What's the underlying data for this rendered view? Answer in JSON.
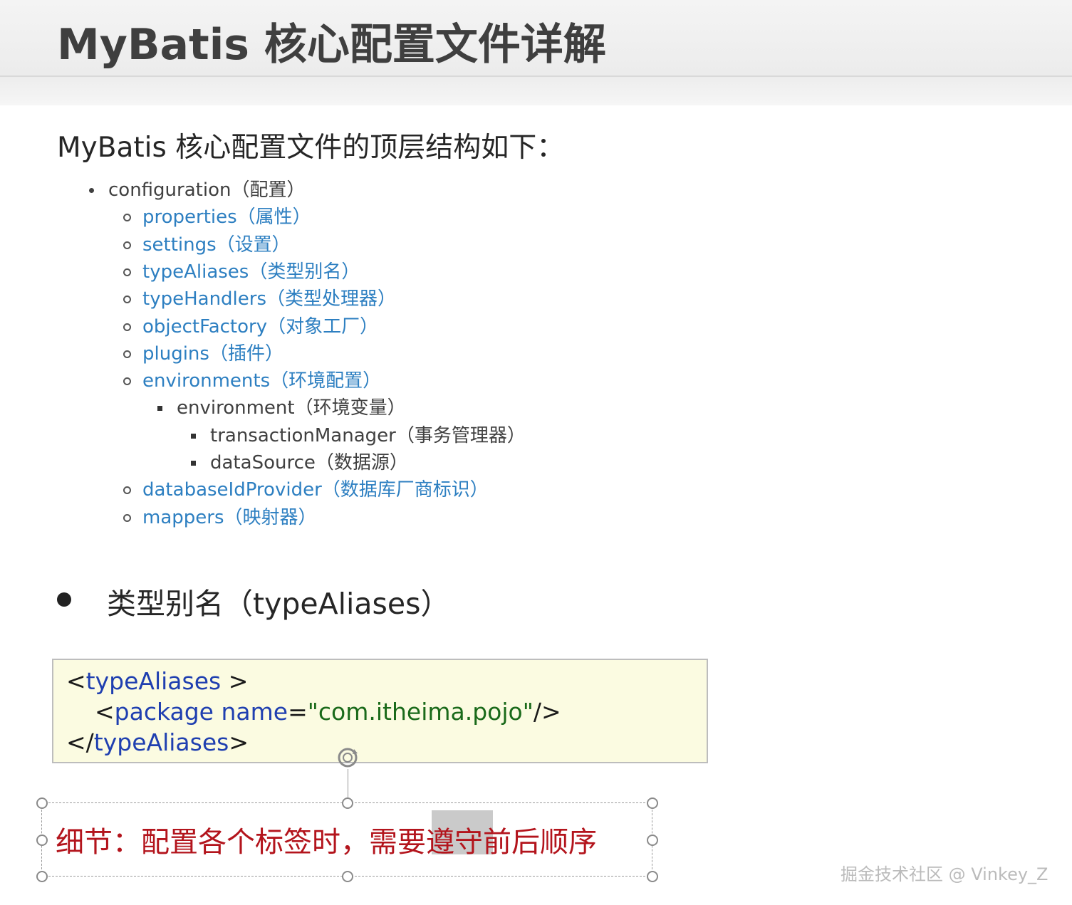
{
  "slide": {
    "title": "MyBatis 核心配置文件详解",
    "intro": "MyBatis 核心配置文件的顶层结构如下：",
    "tree": [
      {
        "level": 1,
        "marker": "disc",
        "label": "configuration（配置）"
      },
      {
        "level": 2,
        "marker": "circle",
        "label": "properties（属性）"
      },
      {
        "level": 2,
        "marker": "circle",
        "label": "settings（设置）"
      },
      {
        "level": 2,
        "marker": "circle",
        "label": "typeAliases（类型别名）"
      },
      {
        "level": 2,
        "marker": "circle",
        "label": "typeHandlers（类型处理器）"
      },
      {
        "level": 2,
        "marker": "circle",
        "label": "objectFactory（对象工厂）"
      },
      {
        "level": 2,
        "marker": "circle",
        "label": "plugins（插件）"
      },
      {
        "level": 2,
        "marker": "circle",
        "label": "environments（环境配置）"
      },
      {
        "level": 3,
        "marker": "square",
        "label": "environment（环境变量）"
      },
      {
        "level": 4,
        "marker": "square",
        "label": "transactionManager（事务管理器）"
      },
      {
        "level": 4,
        "marker": "square",
        "label": "dataSource（数据源）"
      },
      {
        "level": 2,
        "marker": "circle",
        "label": "databaseIdProvider（数据库厂商标识）"
      },
      {
        "level": 2,
        "marker": "circle",
        "label": "mappers（映射器）"
      }
    ],
    "section_heading": "类型别名（typeAliases）",
    "code": {
      "line1_open": "<",
      "line1_name": "typeAliases",
      "line1_close": " >",
      "line2_open": "<",
      "line2_name": "package name",
      "line2_eq": "=",
      "line2_value": "\"com.itheima.pojo\"",
      "line2_close": "/>",
      "line3_open": "</",
      "line3_name": "typeAliases",
      "line3_close": ">"
    },
    "note": "细节：配置各个标签时，需要遵守前后顺序"
  },
  "watermark": "掘金技术社区 @ Vinkey_Z",
  "colors": {
    "link_blue": "#2d7fc1",
    "note_red": "#b3141c",
    "code_bg": "#fbfbe1"
  },
  "icons": {
    "rotate_handle": "rotate-icon"
  }
}
